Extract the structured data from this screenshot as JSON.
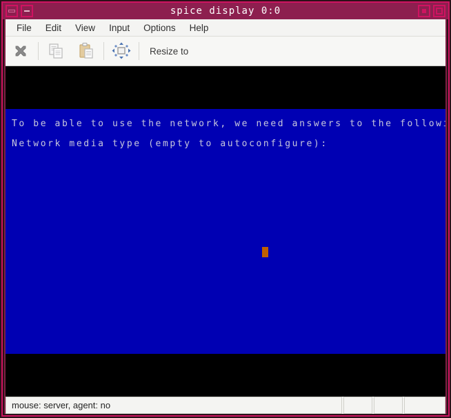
{
  "window": {
    "title": "spice display 0:0",
    "controls": {
      "menu": "window-menu",
      "minimize": "minimize",
      "shade": "shade",
      "close": "close"
    },
    "frame_color": "#cf1361",
    "titlebar_color": "#8d1f4f"
  },
  "menubar": {
    "items": [
      {
        "label": "File"
      },
      {
        "label": "Edit"
      },
      {
        "label": "View"
      },
      {
        "label": "Input"
      },
      {
        "label": "Options"
      },
      {
        "label": "Help"
      }
    ]
  },
  "toolbar": {
    "tools": [
      {
        "name": "disconnect-icon",
        "enabled": true
      },
      {
        "name": "copy-icon",
        "enabled": false
      },
      {
        "name": "paste-icon",
        "enabled": true
      },
      {
        "name": "resize-icon",
        "enabled": true
      }
    ],
    "resize_label": "Resize to"
  },
  "display": {
    "background": "#000000",
    "console_background": "#0000b3",
    "text_color": "#c8c8dc",
    "cursor_color": "#c06000",
    "lines": [
      "To be able to use the network, we need answers to the following:",
      "Network media type (empty to autoconfigure): "
    ]
  },
  "statusbar": {
    "message": "mouse: server, agent:  no",
    "slots": [
      "",
      "",
      ""
    ]
  }
}
